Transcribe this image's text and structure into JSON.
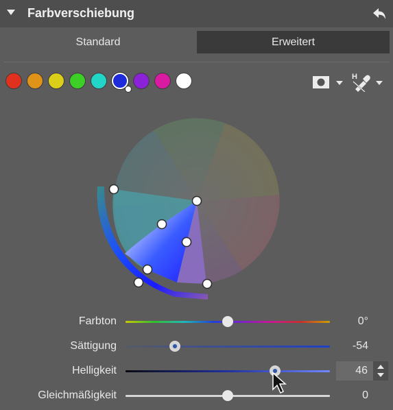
{
  "panel": {
    "title": "Farbverschiebung"
  },
  "tabs": [
    {
      "label": "Standard",
      "active": false
    },
    {
      "label": "Erweitert",
      "active": true
    }
  ],
  "swatches": [
    {
      "name": "red",
      "color": "#e0311f"
    },
    {
      "name": "orange",
      "color": "#e09319"
    },
    {
      "name": "yellow",
      "color": "#dccf1a"
    },
    {
      "name": "green",
      "color": "#3ccf26"
    },
    {
      "name": "cyan",
      "color": "#22d6c7"
    },
    {
      "name": "blue",
      "color": "#1d2bdb",
      "selected": true
    },
    {
      "name": "purple",
      "color": "#8b22d8"
    },
    {
      "name": "magenta",
      "color": "#d81ba0"
    },
    {
      "name": "white",
      "color": "#ffffff"
    }
  ],
  "toolbar": {
    "mask_icon": "mask-icon",
    "picker_icon": "hue-picker-icon"
  },
  "sliders": [
    {
      "label": "Farbton",
      "value": "0°",
      "position": 0.5
    },
    {
      "label": "Sättigung",
      "value": "-54",
      "position": 0.24
    },
    {
      "label": "Helligkeit",
      "value": "46",
      "position": 0.73
    },
    {
      "label": "Gleichmäßigkeit",
      "value": "0",
      "position": 0.5
    }
  ]
}
